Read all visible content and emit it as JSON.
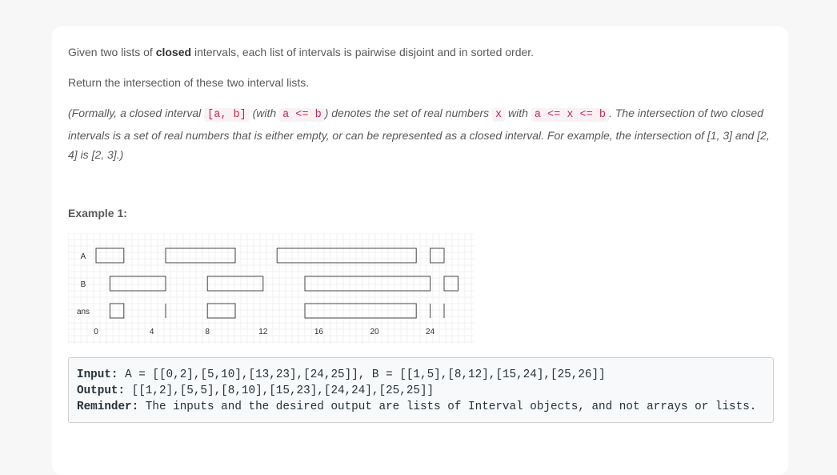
{
  "problem": {
    "p1": {
      "before": "Given two lists of ",
      "bold": "closed",
      "after": " intervals, each list of intervals is pairwise disjoint and in sorted order."
    },
    "p2": "Return the intersection of these two interval lists.",
    "p3": {
      "t1": "(Formally, a closed interval ",
      "c1": "[a, b]",
      "t2": " (with ",
      "c2": "a <= b",
      "t3": ") denotes the set of real numbers ",
      "c3": "x",
      "t4": " with ",
      "c4": "a <= x <= b",
      "t5": ".  The intersection of two closed intervals is a set of real numbers that is either empty, or can be represented as a closed interval.  For example, the intersection of [1, 3] and [2, 4] is [2, 3].)"
    }
  },
  "example": {
    "title": "Example 1:",
    "diagram": {
      "row_labels": [
        "A",
        "B",
        "ans"
      ],
      "x_ticks": [
        "0",
        "4",
        "8",
        "12",
        "16",
        "20",
        "24"
      ],
      "A": [
        [
          0,
          2
        ],
        [
          5,
          10
        ],
        [
          13,
          23
        ],
        [
          24,
          25
        ]
      ],
      "B": [
        [
          1,
          5
        ],
        [
          8,
          12
        ],
        [
          15,
          24
        ],
        [
          25,
          26
        ]
      ],
      "ans": [
        [
          1,
          2
        ],
        [
          5,
          5
        ],
        [
          8,
          10
        ],
        [
          15,
          23
        ],
        [
          24,
          24
        ],
        [
          25,
          25
        ]
      ]
    },
    "input_label": "Input:",
    "input_value": " A = [[0,2],[5,10],[13,23],[24,25]], B = [[1,5],[8,12],[15,24],[25,26]]",
    "output_label": "Output:",
    "output_value": " [[1,2],[5,5],[8,10],[15,23],[24,24],[25,25]]",
    "reminder_label": "Reminder:",
    "reminder_value": " The inputs and the desired output are lists of Interval objects, and not arrays or lists."
  }
}
